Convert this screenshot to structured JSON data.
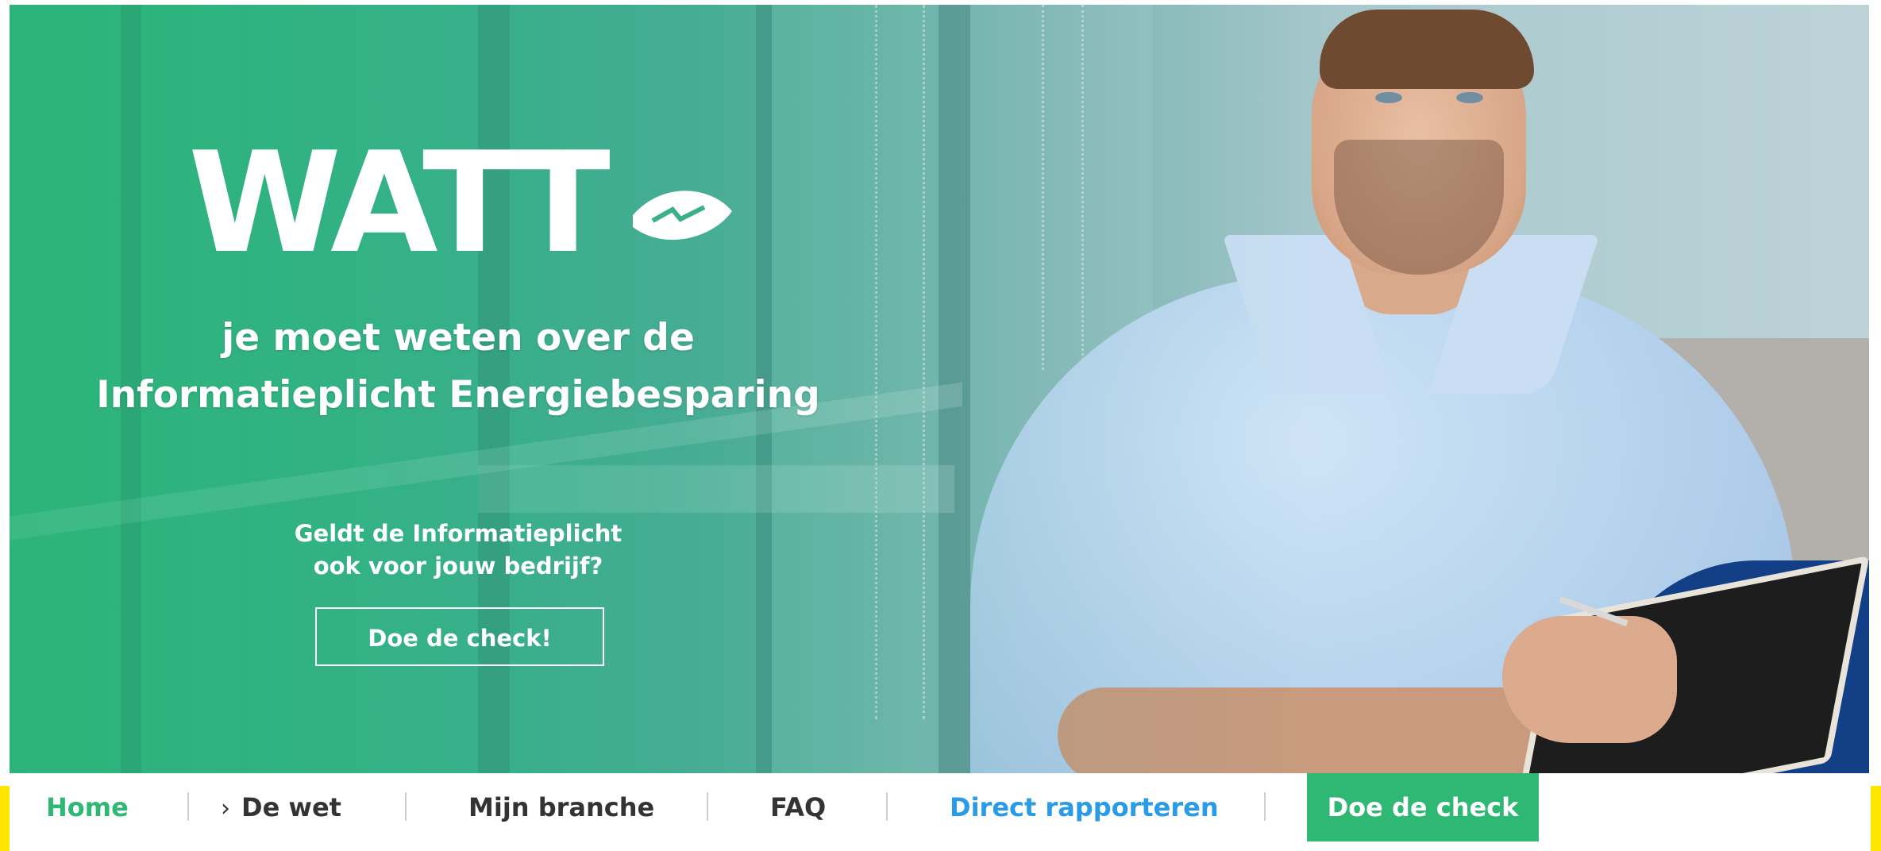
{
  "hero": {
    "logo_text": "WATT",
    "title_line1": "je moet weten over de",
    "title_line2": "Informatieplicht Energiebesparing",
    "question_line1": "Geldt de Informatieplicht",
    "question_line2": "ook voor jouw bedrijf?",
    "check_button_label": "Doe de check!"
  },
  "nav": {
    "items": [
      {
        "label": "Home",
        "active": true
      },
      {
        "label": "De wet",
        "icon": "chevron-right-icon"
      },
      {
        "label": "Mijn branche"
      },
      {
        "label": "FAQ"
      },
      {
        "label": "Direct rapporteren"
      }
    ],
    "cta_label": "Doe de check"
  },
  "colors": {
    "brand_green": "#2fb774",
    "link_blue": "#2a9be6",
    "text_dark": "#333333"
  }
}
